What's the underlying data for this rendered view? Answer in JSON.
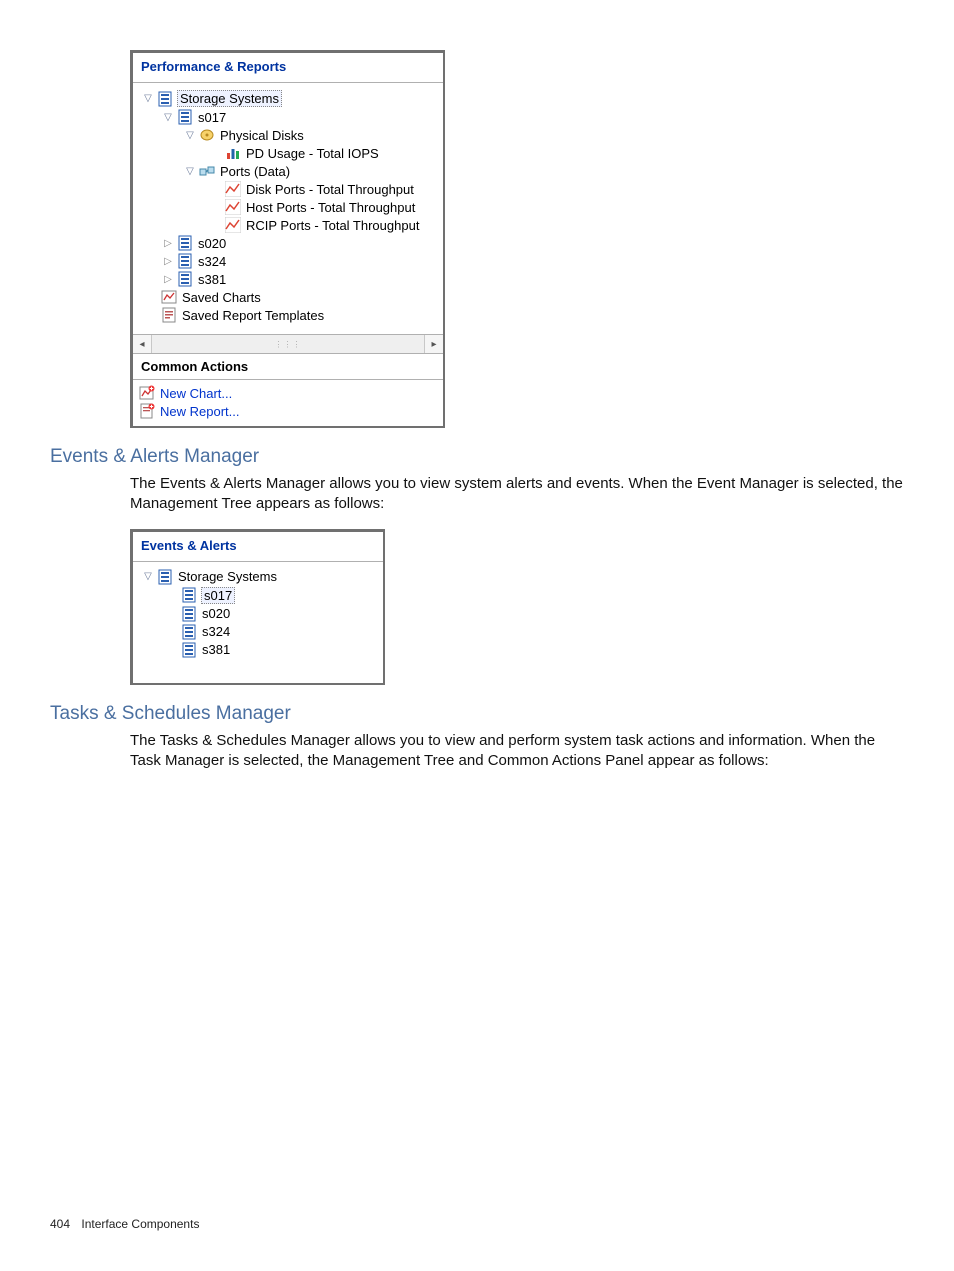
{
  "perf_panel": {
    "title": "Performance & Reports",
    "root_label": "Storage Systems",
    "s017": "s017",
    "physical_disks": "Physical Disks",
    "pd_usage": "PD Usage - Total IOPS",
    "ports_data": "Ports (Data)",
    "disk_ports": "Disk Ports - Total Throughput",
    "host_ports": "Host Ports - Total Throughput",
    "rcip_ports": "RCIP Ports - Total Throughput",
    "s020": "s020",
    "s324": "s324",
    "s381": "s381",
    "saved_charts": "Saved Charts",
    "saved_templates": "Saved Report Templates",
    "common_actions_header": "Common Actions",
    "new_chart": "New Chart...",
    "new_report": "New Report..."
  },
  "section1": {
    "heading": "Events & Alerts Manager",
    "body": "The Events & Alerts Manager allows you to view system alerts and events. When the Event Manager is selected, the Management Tree appears as follows:"
  },
  "events_panel": {
    "title": "Events & Alerts",
    "root_label": "Storage Systems",
    "s017": "s017",
    "s020": "s020",
    "s324": "s324",
    "s381": "s381"
  },
  "section2": {
    "heading": "Tasks & Schedules Manager",
    "body": "The Tasks & Schedules Manager allows you to view and perform system task actions and information. When the Task Manager is selected, the Management Tree and Common Actions Panel appear as follows:"
  },
  "footer": {
    "page_number": "404",
    "section": "Interface Components"
  }
}
